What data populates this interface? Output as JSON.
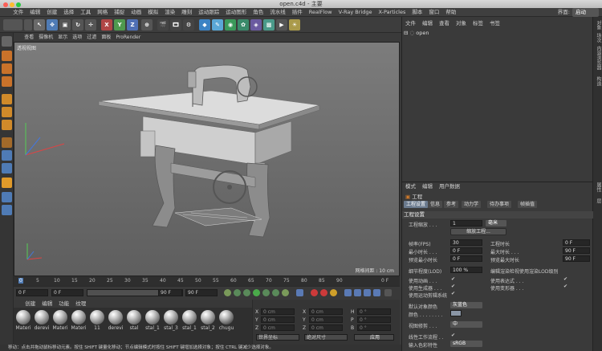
{
  "window": {
    "title": "open.c4d - 主要"
  },
  "menu": [
    "文件",
    "编辑",
    "创建",
    "选择",
    "工具",
    "网格",
    "捕捉",
    "动画",
    "模拟",
    "渲染",
    "雕刻",
    "运动跟踪",
    "运动图形",
    "角色",
    "流水线",
    "插件",
    "RealFlow",
    "V-Ray Bridge",
    "X-Particles",
    "脚本",
    "窗口",
    "帮助"
  ],
  "layout": {
    "label": "界面:",
    "value": "启动"
  },
  "toolbar": {
    "x": "X",
    "y": "Y",
    "z": "Z"
  },
  "viewport": {
    "menu": [
      "查看",
      "摄像机",
      "显示",
      "选项",
      "过滤",
      "面板",
      "ProRender"
    ],
    "label": "透视视图",
    "grid": "网格间距 : 10 cm"
  },
  "timeline": {
    "ticks": [
      "0",
      "5",
      "10",
      "15",
      "20",
      "25",
      "30",
      "35",
      "40",
      "45",
      "50",
      "55",
      "60",
      "65",
      "70",
      "75",
      "80",
      "85",
      "90"
    ],
    "end": "0 F"
  },
  "transport": {
    "f1": "0 F",
    "f2": "0 F",
    "f3": "90 F",
    "f4": "90 F"
  },
  "materials": {
    "menu": [
      "创建",
      "编辑",
      "功能",
      "纹理"
    ],
    "items": [
      "Materi",
      "derevi",
      "Materi",
      "Materi",
      "11",
      "derevi",
      "stal",
      "stal_1",
      "stal_3",
      "stal_1",
      "stal_2",
      "chugu"
    ]
  },
  "coords": {
    "rows": [
      {
        "a": "X",
        "v1": "0 cm",
        "b": "X",
        "v2": "0 cm",
        "c": "H",
        "v3": "0 °"
      },
      {
        "a": "Y",
        "v1": "0 cm",
        "b": "Y",
        "v2": "0 cm",
        "c": "P",
        "v3": "0 °"
      },
      {
        "a": "Z",
        "v1": "0 cm",
        "b": "Z",
        "v2": "0 cm",
        "c": "B",
        "v3": "0 °"
      }
    ],
    "mode": "世界坐标",
    "scale": "绝对尺寸",
    "apply": "应用"
  },
  "status": "移动：点击并拖动鼠标移动元素。按住 SHIFT 键量化移动；节点编辑模式时按住 SHIFT 键增加选择对象；按住 CTRL 键减少选择对象。",
  "objects": {
    "menu": [
      "文件",
      "编辑",
      "查看",
      "对象",
      "标签",
      "书签"
    ],
    "root": "open"
  },
  "rightTabs": [
    "对象",
    "场次",
    "内容浏览器",
    "构造",
    "属性",
    "层"
  ],
  "attributes": {
    "menu": [
      "模式",
      "编辑",
      "用户数据"
    ],
    "title": "工程",
    "tabs": [
      "工程设置",
      "信息",
      "参考",
      "动力学",
      "待办事项",
      "帧插值"
    ],
    "section": "工程设置",
    "scale_label": "工程缩放 . . .",
    "scale_value": "1",
    "scale_unit": "毫米",
    "scale_button": "缩放工程...",
    "fps_label": "帧率(FPS)",
    "fps": "30",
    "time_label": "工程时长",
    "time": "0 F",
    "min_label": "最小时长 . . .",
    "min": "0 F",
    "max_label": "最大时长 . . .",
    "max": "90 F",
    "pmin_label": "预览最小时长",
    "pmin": "0 F",
    "pmax_label": "预览最大时长",
    "pmax": "90 F",
    "lod_label": "细节程度(LOD)",
    "lod": "100 %",
    "lod_render": "编辑渲染检视使用渲染LOD级别",
    "anim": "使用动画 . . .",
    "expr": "使用表达式 . . .",
    "gen": "使用生成器 . . .",
    "deform": "使用变形器 . . .",
    "motion": "使用运动剪辑系统",
    "color_label": "默认对象颜色",
    "color_value": "灰蓝色",
    "color2_label": "颜色 . . . . . . . .",
    "clip_label": "视图修剪 . . .",
    "clip_value": "中",
    "linear": "线性工作流程 . .",
    "input_label": "输入色彩特性",
    "input_value": "sRGB"
  }
}
